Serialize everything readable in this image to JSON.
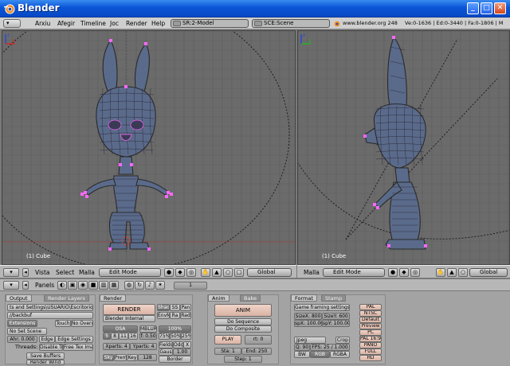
{
  "window": {
    "title": "Blender"
  },
  "topbar": {
    "menus": [
      "Arxiu",
      "Afegir",
      "Timeline",
      "Joc",
      "Render",
      "Help"
    ],
    "screen": "SR:2-Model",
    "scene": "SCE:Scene",
    "url": "www.blender.org 248",
    "stats": "Ve:0-1636 | Ed:0-3440 | Fa:0-1806 | M"
  },
  "viewport_left": {
    "label": "(1) Cube"
  },
  "viewport_right": {
    "label": "(1) Cube"
  },
  "header_left": {
    "view": "Vista",
    "select": "Select",
    "mesh": "Malla",
    "mode": "Edit Mode",
    "orient": "Global"
  },
  "header_right": {
    "mesh": "Malla",
    "mode": "Edit Mode",
    "orient": "Global"
  },
  "buttons_header": {
    "panels": "Panels",
    "frame": "1"
  },
  "output_panel": {
    "tab1": "Output",
    "tab2": "Render Layers",
    "path1": "ts and Settings\\USUARIO\\Escritorio\\",
    "path2": "//backbuf",
    "extensions": "Extensions",
    "touch": "Touch",
    "no_overwrite": "No Overwr",
    "no_set_scene": "No Set Scene",
    "ahr": "Ahr: 0.000",
    "edge": "Edge",
    "edge_settings": "Edge Settings",
    "threads": "Threads:",
    "disable_tr": "Disable Tr",
    "free_tex": "Free Tex Ima",
    "save_buffers": "Save Buffers",
    "render_window": "Render Wind"
  },
  "render_panel": {
    "tab1": "Render",
    "render": "RENDER",
    "shad": "Shad",
    "ss": "SS",
    "pan": "Pan",
    "engine": "Blender Internal",
    "envm": "EnvM",
    "ra": "Ra",
    "rad": "Rad",
    "osa": "OSA",
    "mblur": "MBLUR",
    "osa_levels": [
      "5",
      "8",
      "11",
      "16"
    ],
    "mblur_val": "f: 0.50",
    "percent": "100%",
    "pct_levels": [
      "75%",
      "50%",
      "25%"
    ],
    "xparts": "Xparts: 4",
    "yparts": "Yparts: 4",
    "fields": "Fields",
    "odd": "Odd",
    "x": "X",
    "gaus": "Gaus",
    "gaus_val": "1.00",
    "sky": "Sky",
    "prem": "Prem",
    "key": "Key",
    "key_val": "128",
    "border": "Border"
  },
  "anim_panel": {
    "tab1": "Anim",
    "tab2": "Bake",
    "anim": "ANIM",
    "do_sequence": "Do Sequence",
    "do_composite": "Do Composite",
    "play": "PLAY",
    "rt": "rt: 0",
    "sta": "Sta: 1",
    "end": "End: 250",
    "step": "Step: 1"
  },
  "format_panel": {
    "tab1": "Format",
    "tab2": "Stamp",
    "game_settings": "Game framing settings",
    "sizex": "SizeX: 800",
    "sizey": "SizeY: 600",
    "aspx": "spX: 100.00",
    "aspy": "spY: 100.00",
    "format": "Jpeg",
    "crop": "Crop",
    "q": "Q: 90",
    "fps": "FPS: 25 / 1.000",
    "bw": "BW",
    "rgb": "RGB",
    "rgba": "RGBA",
    "presets": [
      "PAL",
      "NTSC",
      "Default",
      "Preview",
      "PC",
      "PAL 16:9",
      "PANO",
      "FULL",
      "HD"
    ]
  },
  "colors": {
    "titlebar": "#0a55d8",
    "mesh_edge": "#2a2a2a",
    "mesh_face": "#5a6a8a",
    "selected_vertex": "#ff66ff"
  }
}
